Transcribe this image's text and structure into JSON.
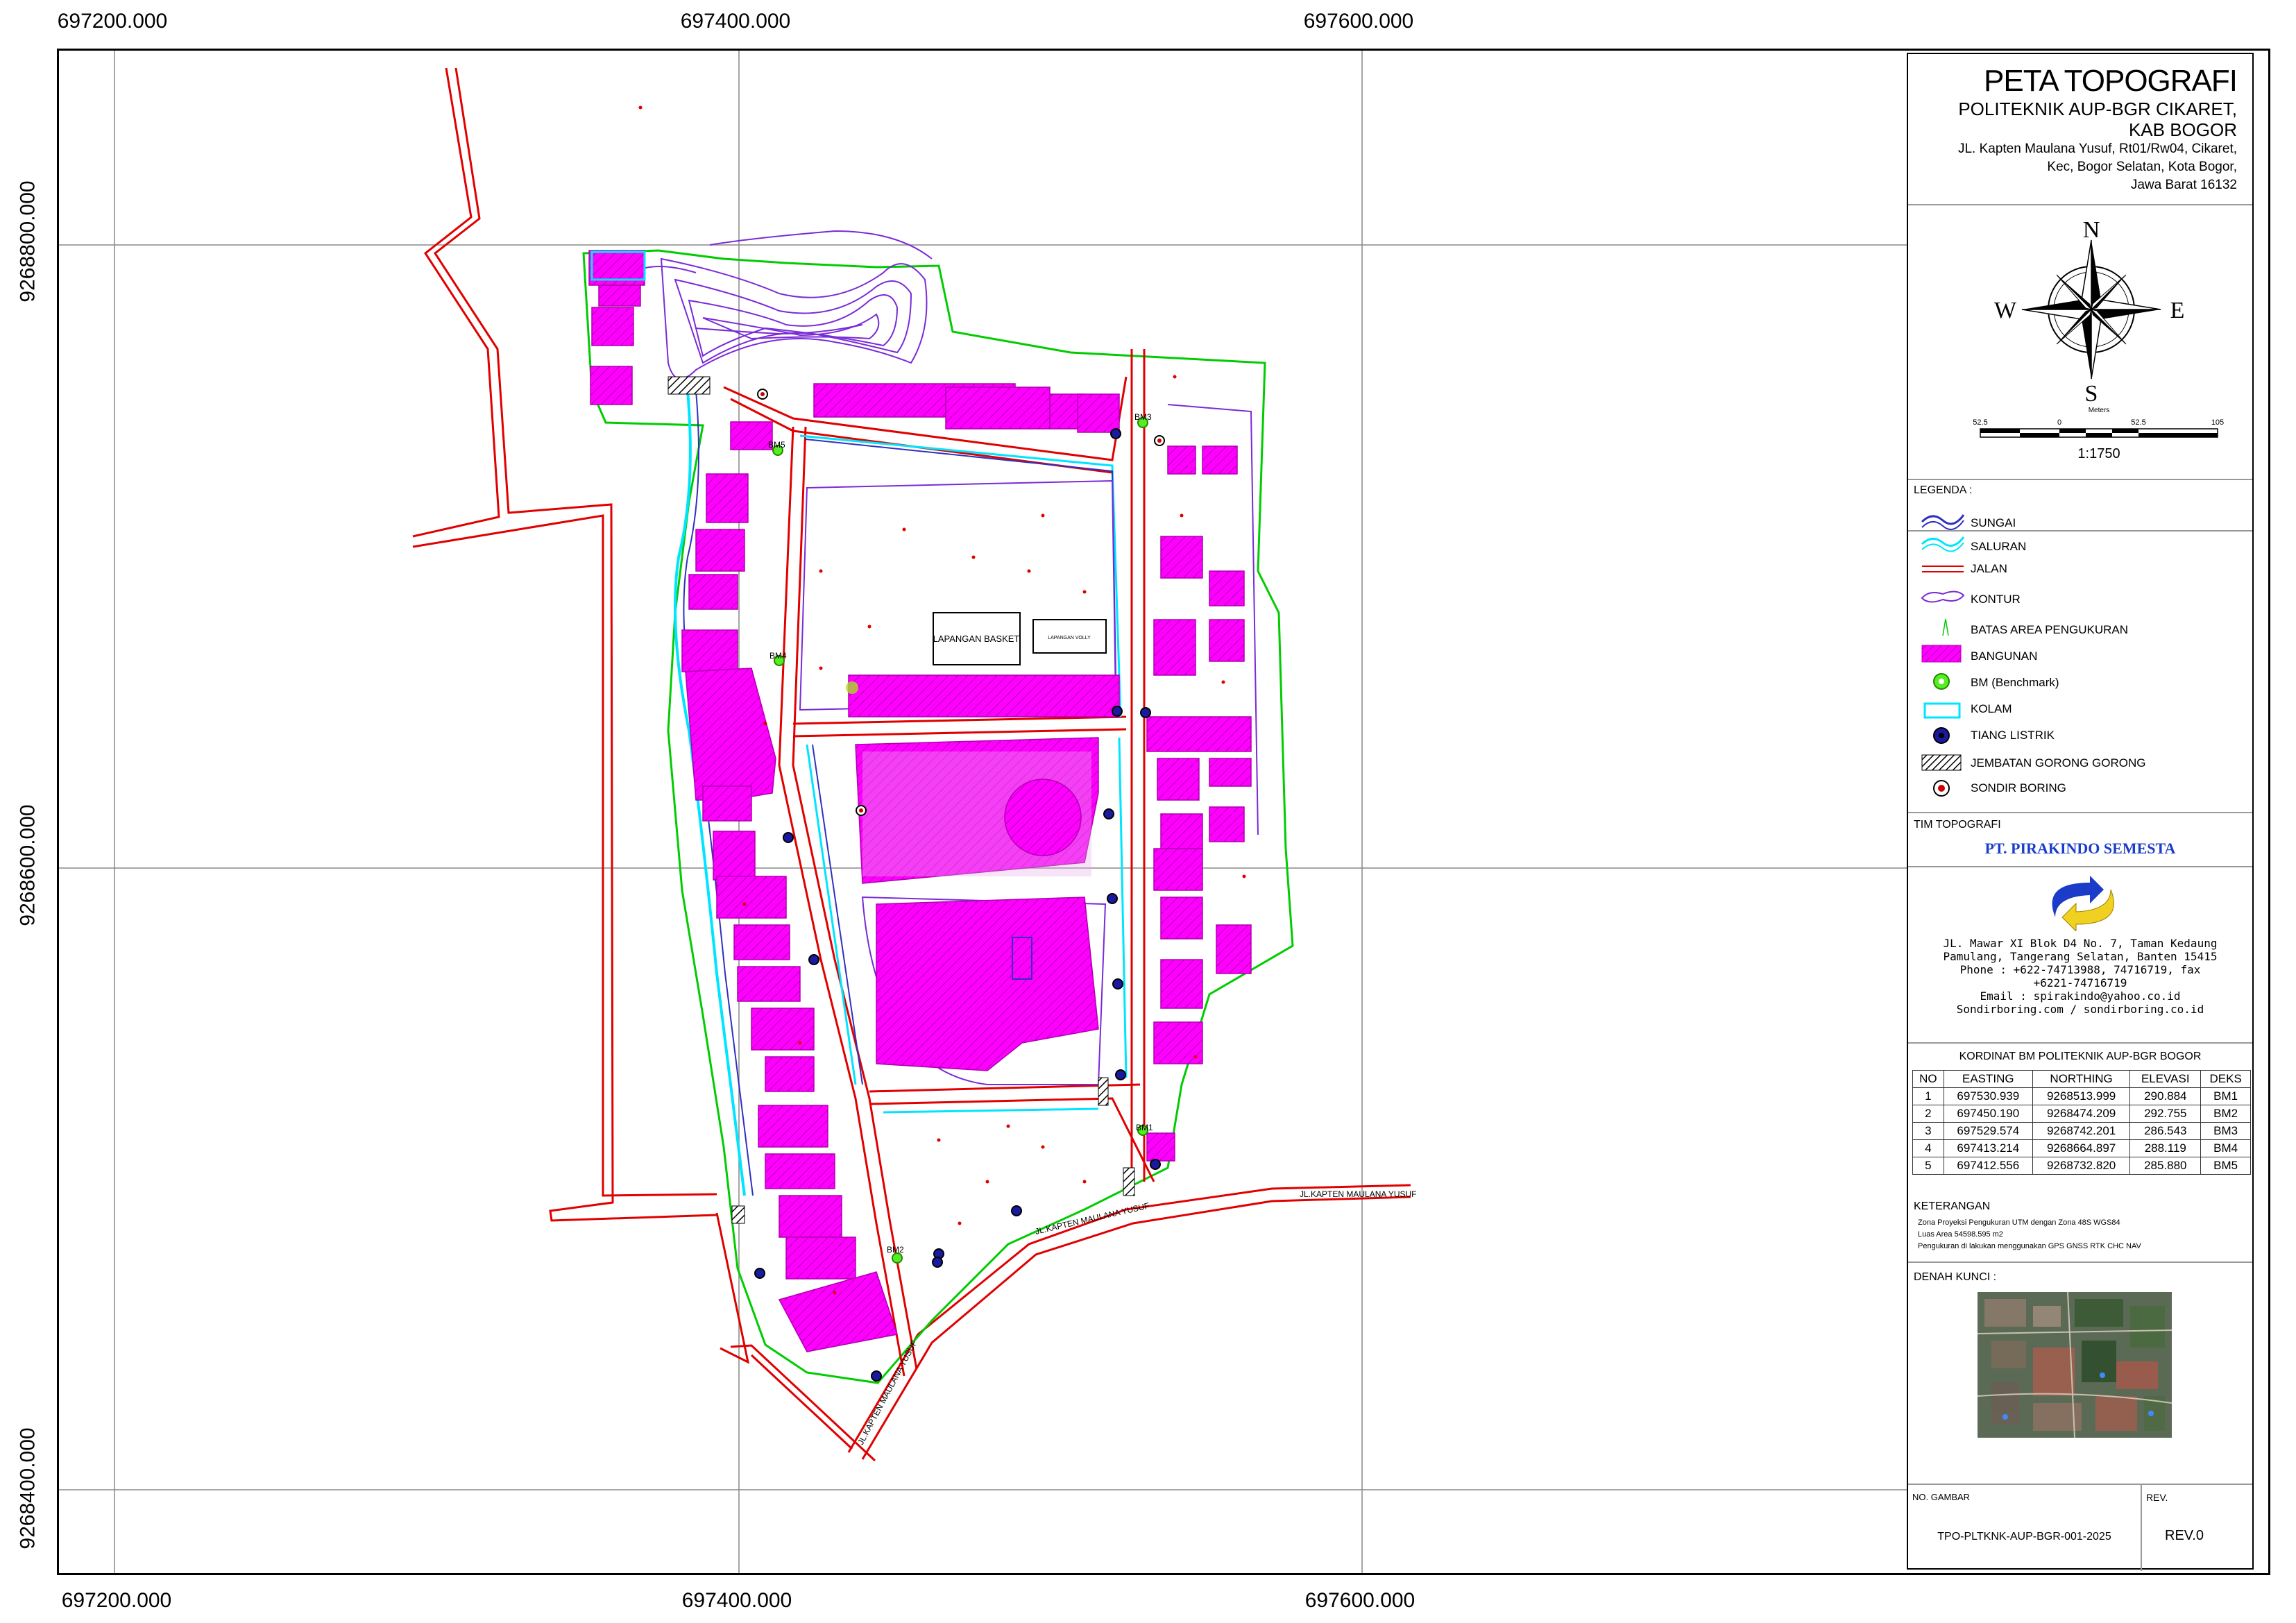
{
  "grid": {
    "x_labels": [
      "697200.000",
      "697400.000",
      "697600.000"
    ],
    "y_labels": [
      "9268800.000",
      "9268600.000",
      "9268400.000"
    ]
  },
  "map": {
    "labels": {
      "lapangan_basket": "LAPANGAN BASKET",
      "lapangan_volly": "LAPANGAN VOLLY",
      "jl_kapten_1": "JL.KAPTEN MAULANA YUSUF",
      "jl_kapten_2": "JL.KAPTEN MAULANA YUSUF",
      "jl_kapten_3": "JL.KAPTEN MAULANA YUSUF"
    },
    "bm_labels": [
      "BM1",
      "BM2",
      "BM3",
      "BM4",
      "BM5"
    ],
    "colors": {
      "building": "#ff00ff",
      "road": "#e00000",
      "boundary": "#00cc00",
      "channel": "#00e5ff",
      "river": "#3030c0",
      "contour": "#7a2bd6"
    }
  },
  "title_block": {
    "title": "PETA TOPOGRAFI",
    "subtitle1": "POLITEKNIK AUP-BGR CIKARET,",
    "subtitle2": "KAB BOGOR",
    "address1": "JL. Kapten Maulana Yusuf, Rt01/Rw04, Cikaret,",
    "address2": "Kec, Bogor Selatan, Kota Bogor,",
    "address3": "Jawa Barat 16132",
    "compass": {
      "n": "N",
      "s": "S",
      "e": "E",
      "w": "W"
    },
    "scale": {
      "ticks": [
        "52.5",
        "0",
        "52.5",
        "105"
      ],
      "unit": "Meters",
      "ratio": "1:1750"
    },
    "legend_title": "LEGENDA :",
    "legend": [
      {
        "label": "SUNGAI",
        "icon": "river-icon"
      },
      {
        "label": "SALURAN",
        "icon": "channel-icon"
      },
      {
        "label": "JALAN",
        "icon": "road-icon"
      },
      {
        "label": "KONTUR",
        "icon": "contour-icon"
      },
      {
        "label": "BATAS AREA PENGUKURAN",
        "icon": "boundary-icon"
      },
      {
        "label": "BANGUNAN",
        "icon": "building-icon"
      },
      {
        "label": "BM (Benchmark)",
        "icon": "benchmark-icon"
      },
      {
        "label": "KOLAM",
        "icon": "pond-icon"
      },
      {
        "label": "TIANG LISTRIK",
        "icon": "power-pole-icon"
      },
      {
        "label": "JEMBATAN GORONG GORONG",
        "icon": "culvert-icon"
      },
      {
        "label": "SONDIR BORING",
        "icon": "sondir-icon"
      }
    ],
    "team_title": "TIM TOPOGRAFI",
    "company": "PT. PIRAKINDO SEMESTA",
    "company_address": [
      "JL. Mawar XI Blok D4 No. 7, Taman Kedaung",
      "Pamulang, Tangerang Selatan, Banten 15415",
      "Phone : +622-74713988, 74716719, fax",
      "+6221-74716719",
      "Email : spirakindo@yahoo.co.id",
      "Sondirboring.com / sondirboring.co.id"
    ],
    "bm_table": {
      "title": "KORDINAT BM POLITEKNIK AUP-BGR BOGOR",
      "headers": [
        "NO",
        "EASTING",
        "NORTHING",
        "ELEVASI",
        "DEKS"
      ],
      "rows": [
        [
          "1",
          "697530.939",
          "9268513.999",
          "290.884",
          "BM1"
        ],
        [
          "2",
          "697450.190",
          "9268474.209",
          "292.755",
          "BM2"
        ],
        [
          "3",
          "697529.574",
          "9268742.201",
          "286.543",
          "BM3"
        ],
        [
          "4",
          "697413.214",
          "9268664.897",
          "288.119",
          "BM4"
        ],
        [
          "5",
          "697412.556",
          "9268732.820",
          "285.880",
          "BM5"
        ]
      ]
    },
    "notes_title": "KETERANGAN",
    "notes": [
      "Zona Proyeksi Pengukuran UTM dengan Zona 48S WGS84",
      "Luas Area 54598.595 m2",
      "Pengukuran di lakukan menggunakan GPS GNSS RTK CHC NAV"
    ],
    "key_map_title": "DENAH KUNCI :",
    "drawing_no_label": "NO. GAMBAR",
    "drawing_no": "TPO-PLTKNK-AUP-BGR-001-2025",
    "rev_label": "REV.",
    "rev": "REV.0"
  }
}
